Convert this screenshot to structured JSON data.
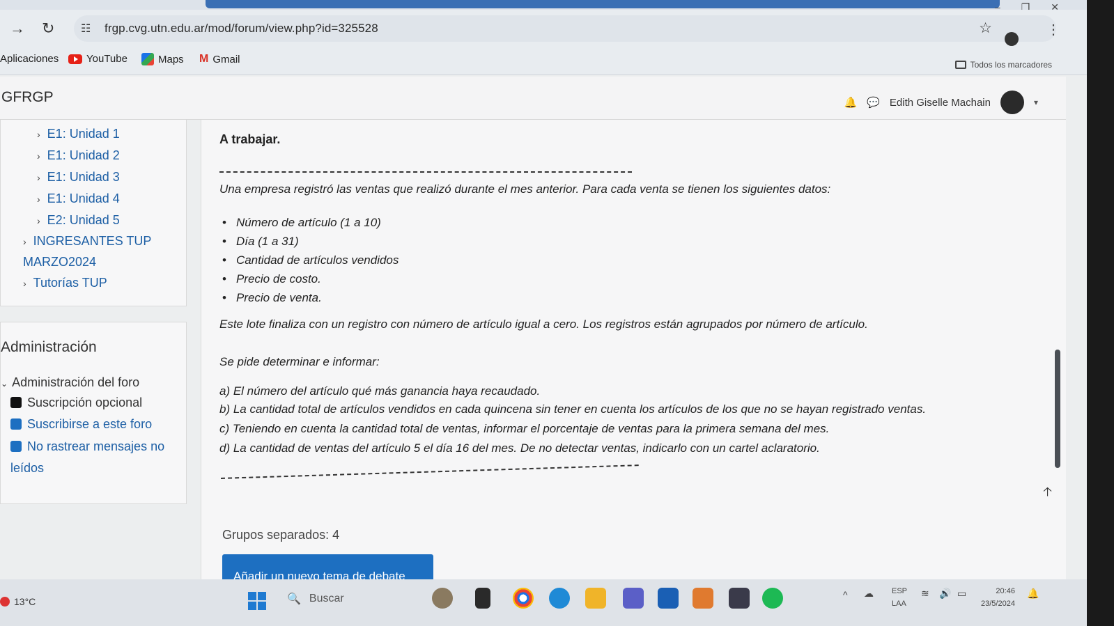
{
  "browser": {
    "url": "frgp.cvg.utn.edu.ar/mod/forum/view.php?id=325528",
    "bookmarks": [
      "Aplicaciones",
      "YouTube",
      "Maps",
      "Gmail"
    ],
    "all_bookmarks": "Todos los marcadores"
  },
  "site": {
    "brand": "GFRGP",
    "user_name": "Edith Giselle Machain"
  },
  "sidebar": {
    "items": [
      {
        "label": "E1: Unidad 1"
      },
      {
        "label": "E1: Unidad 2"
      },
      {
        "label": "E1: Unidad 3"
      },
      {
        "label": "E1: Unidad 4"
      },
      {
        "label": "E2: Unidad 5"
      },
      {
        "label": "INGRESANTES TUP"
      },
      {
        "label": "MARZO2024"
      },
      {
        "label": "Tutorías TUP"
      }
    ]
  },
  "admin": {
    "title": "Administración",
    "subtitle": "Administración del foro",
    "items": [
      {
        "label": "Suscripción opcional",
        "color": "#111111"
      },
      {
        "label": "Suscribirse a este foro",
        "color": "#1d6fc1"
      },
      {
        "label": "No rastrear mensajes no leídos",
        "color": "#1d6fc1"
      }
    ]
  },
  "content": {
    "heading": "A trabajar.",
    "intro": "Una empresa registró las ventas que realizó durante el mes anterior. Para cada venta se tienen los siguientes datos:",
    "bullets": [
      "Número de artículo (1 a 10)",
      "Día (1 a 31)",
      "Cantidad de artículos vendidos",
      "Precio de costo.",
      "Precio de venta."
    ],
    "lote": "Este lote finaliza con un registro con número de artículo igual a cero. Los registros están agrupados por número de artículo.",
    "pide": "Se pide determinar e informar:",
    "tasks": [
      "a) El número del artículo qué más ganancia haya recaudado.",
      "b) La cantidad total de artículos vendidos en cada quincena sin tener en cuenta los artículos de los que no se hayan registrado ventas.",
      "c) Teniendo en cuenta la cantidad total de ventas, informar el porcentaje de ventas para la primera semana del mes.",
      "d) La cantidad de ventas del artículo 5 el día 16 del mes. De no detectar ventas, indicarlo con un cartel aclaratorio."
    ],
    "groups": "Grupos separados: 4",
    "add_button": "Añadir un nuevo tema de debate"
  },
  "taskbar": {
    "temperature": "13°C",
    "search": "Buscar",
    "lang1": "ESP",
    "lang2": "LAA",
    "time": "20:46",
    "date": "23/5/2024"
  }
}
